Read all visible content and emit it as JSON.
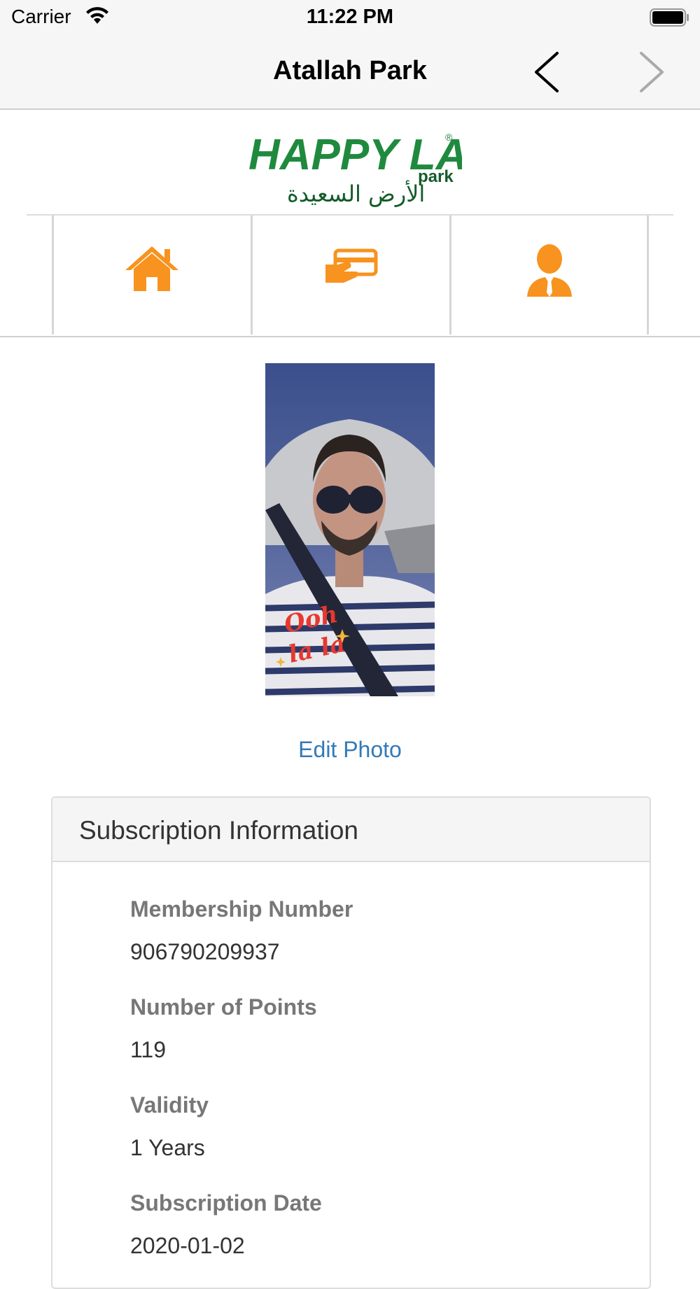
{
  "status_bar": {
    "carrier": "Carrier",
    "time": "11:22 PM"
  },
  "nav": {
    "title": "Atallah Park"
  },
  "logo": {
    "text": "HAPPY LAND",
    "sub": "park",
    "arabic": "الأرض السعيدة",
    "registered": "®"
  },
  "tabs": [
    {
      "name": "home",
      "icon": "home-icon"
    },
    {
      "name": "card",
      "icon": "card-payment-icon"
    },
    {
      "name": "profile",
      "icon": "user-profile-icon"
    }
  ],
  "profile": {
    "photo_overlay": [
      "Ooh",
      "la la"
    ],
    "edit_photo": "Edit Photo"
  },
  "subscription": {
    "title": "Subscription Information",
    "fields": [
      {
        "label": "Membership Number",
        "value": "906790209937"
      },
      {
        "label": "Number of Points",
        "value": "119"
      },
      {
        "label": "Validity",
        "value": "1 Years"
      },
      {
        "label": "Subscription Date",
        "value": "2020-01-02"
      }
    ]
  },
  "colors": {
    "accent": "#f7931e",
    "link": "#337ab7",
    "logo_green": "#1f8a3e"
  }
}
